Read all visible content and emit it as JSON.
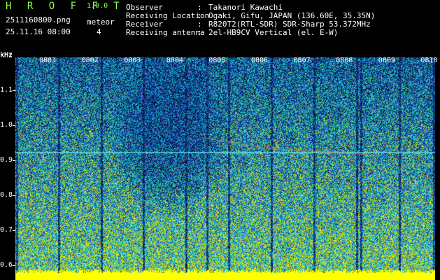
{
  "app": {
    "logo": "H R O F F T",
    "version": "1.0.0"
  },
  "file": {
    "name": "2511160800.png",
    "datetime": "25.11.16 08:00"
  },
  "meteor": {
    "label": "meteor",
    "count": "4"
  },
  "info": [
    {
      "label": "Observer",
      "value": "Takanori Kawachi"
    },
    {
      "label": "Receiving Location",
      "value": "Ogaki, Gifu, JAPAN (136.60E, 35.35N)"
    },
    {
      "label": "Receiver",
      "value": "R820T2(RTL-SDR) SDR-Sharp 53.372MHz"
    },
    {
      "label": "Receiving antenna",
      "value": "2el-HB9CV Vertical (el. E-W)"
    }
  ],
  "axis": {
    "unit": "kHz",
    "y_ticks": [
      "1.1",
      "1.0",
      "0.9",
      "0.8",
      "0.7",
      "0.6"
    ],
    "x_ticks": [
      "0801",
      "0802",
      "0803",
      "0804",
      "0805",
      "0806",
      "0807",
      "0808",
      "0809",
      "0810"
    ]
  },
  "colors": {
    "background": "#000000",
    "logo": "#8fff4f",
    "spectrum_low": "#1a2a9a",
    "spectrum_mid": "#18c8c8",
    "spectrum_high": "#e8e800",
    "baseline": "#ffff00"
  }
}
